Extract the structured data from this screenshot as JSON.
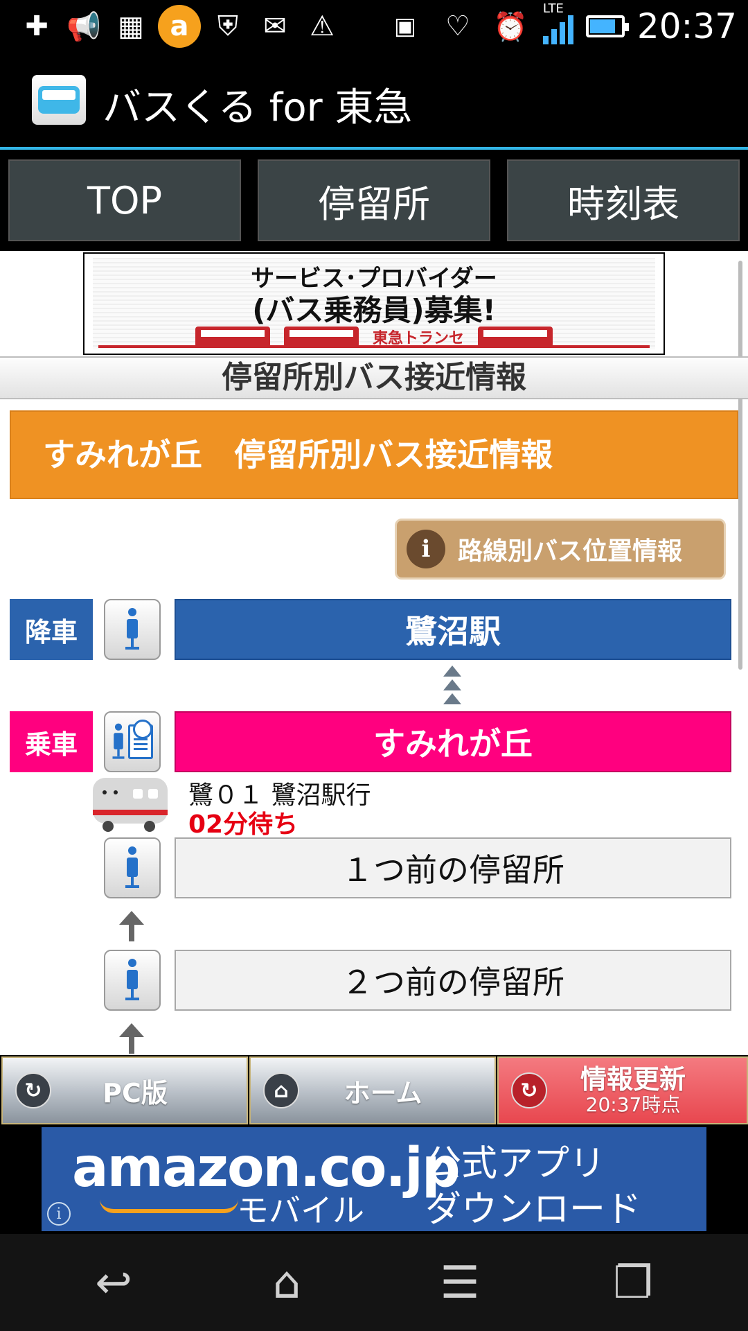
{
  "status_bar": {
    "time": "20:37",
    "network": "LTE",
    "left_icons": [
      "plus-icon",
      "speaker-icon",
      "image-icon",
      "app-circle-icon",
      "shield-phone-icon",
      "mail-icon",
      "warning-icon"
    ],
    "right_icons": [
      "voicemail-icon",
      "heart-icon",
      "alarm-icon",
      "signal-icon",
      "battery-icon"
    ]
  },
  "app_bar": {
    "title": "バスくる for 東急"
  },
  "nav": {
    "tabs": [
      {
        "label": "TOP"
      },
      {
        "label": "停留所"
      },
      {
        "label": "時刻表"
      }
    ]
  },
  "banner": {
    "line1": "サービス･プロバイダー",
    "line2": "(バス乗務員)募集!",
    "company": "東急トランセ"
  },
  "section": {
    "title": "停留所別バス接近情報",
    "stop_heading": "すみれが丘　停留所別バス接近情報",
    "route_button": "路線別バス位置情報",
    "route_button_icon": "i"
  },
  "stops": {
    "alight_tag": "降車",
    "alight_stop": "鷺沼駅",
    "board_tag": "乗車",
    "board_stop": "すみれが丘",
    "prev1": "１つ前の停留所",
    "prev2": "２つ前の停留所"
  },
  "bus": {
    "route": "鷺０１ 鷺沼駅行",
    "wait": "02分待ち"
  },
  "toolbar": {
    "pc_label": "PC版",
    "home_label": "ホーム",
    "refresh_label": "情報更新",
    "refresh_time": "20:37時点"
  },
  "ad": {
    "logo": "amazon.co.jp",
    "mobile": "モバイル",
    "copy1": "公式アプリ",
    "copy2": "ダウンロード",
    "info": "i"
  },
  "colors": {
    "accent_blue": "#33b5e5",
    "orange": "#ef9223",
    "alight_blue": "#2b63ad",
    "board_pink": "#ff007f",
    "wait_red": "#e60012"
  }
}
